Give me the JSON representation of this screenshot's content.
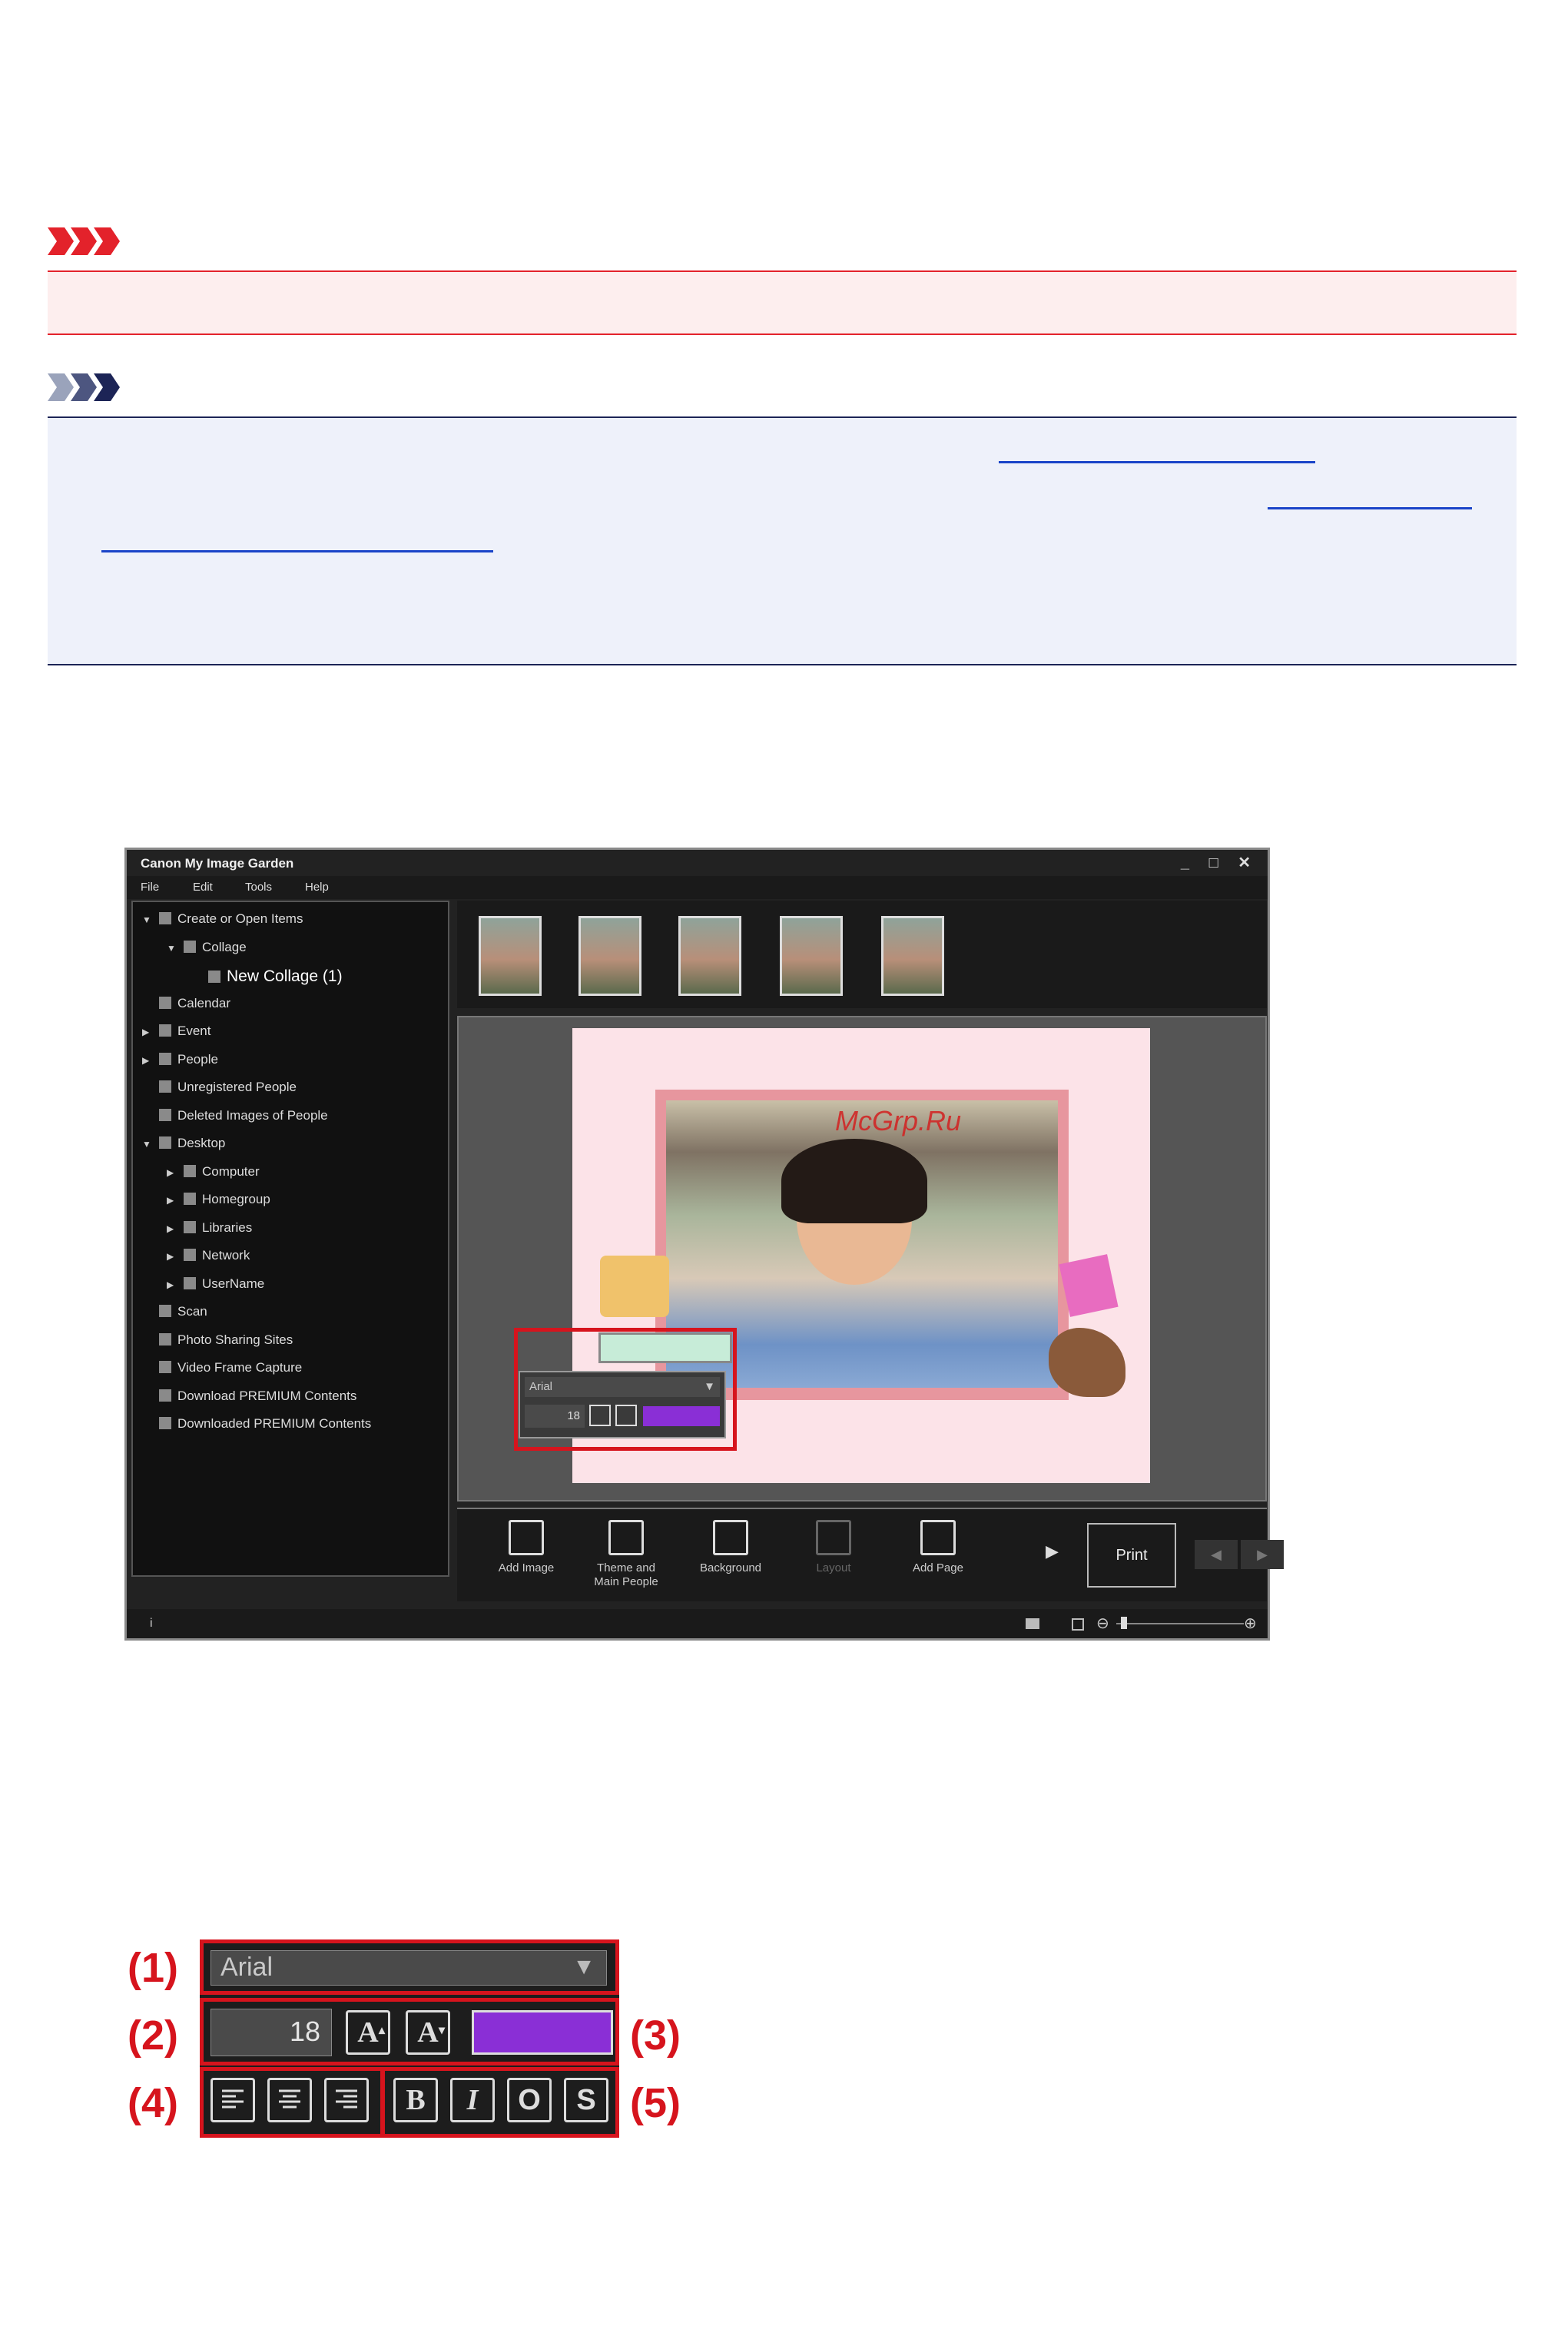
{
  "app": {
    "title": "Canon My Image Garden",
    "window_controls": "_ □ ✕",
    "menu": [
      "File",
      "Edit",
      "Tools",
      "Help"
    ],
    "tree": [
      {
        "label": "Create or Open Items",
        "level": 0,
        "arrow": "▼"
      },
      {
        "label": "Collage",
        "level": 1,
        "arrow": "▼"
      },
      {
        "label": "New Collage (1)",
        "level": 2,
        "arrow": ""
      },
      {
        "label": "Calendar",
        "level": 0,
        "arrow": ""
      },
      {
        "label": "Event",
        "level": 0,
        "arrow": "▶"
      },
      {
        "label": "People",
        "level": 0,
        "arrow": "▶"
      },
      {
        "label": "Unregistered People",
        "level": 0,
        "arrow": ""
      },
      {
        "label": "Deleted Images of People",
        "level": 0,
        "arrow": ""
      },
      {
        "label": "Desktop",
        "level": 0,
        "arrow": "▼"
      },
      {
        "label": "Computer",
        "level": 1,
        "arrow": "▶"
      },
      {
        "label": "Homegroup",
        "level": 1,
        "arrow": "▶"
      },
      {
        "label": "Libraries",
        "level": 1,
        "arrow": "▶"
      },
      {
        "label": "Network",
        "level": 1,
        "arrow": "▶"
      },
      {
        "label": "UserName",
        "level": 1,
        "arrow": "▶"
      },
      {
        "label": "Scan",
        "level": 0,
        "arrow": ""
      },
      {
        "label": "Photo Sharing Sites",
        "level": 0,
        "arrow": ""
      },
      {
        "label": "Video Frame Capture",
        "level": 0,
        "arrow": ""
      },
      {
        "label": "Download PREMIUM Contents",
        "level": 0,
        "arrow": ""
      },
      {
        "label": "Downloaded PREMIUM Contents",
        "level": 0,
        "arrow": ""
      }
    ],
    "watermark": "McGrp.Ru",
    "mini_panel": {
      "font": "Arial",
      "size": "18"
    },
    "toolbar": {
      "buttons": [
        {
          "label": "Add Image",
          "disabled": false
        },
        {
          "label": "Theme and Main People",
          "disabled": false
        },
        {
          "label": "Background",
          "disabled": false
        },
        {
          "label": "Layout",
          "disabled": true
        },
        {
          "label": "Add Page",
          "disabled": false
        }
      ],
      "more_arrow": "▶",
      "print": "Print",
      "nav": [
        "◀",
        "▶"
      ]
    },
    "status": {
      "info": "i",
      "zoom_out": "⊖",
      "zoom_in": "⊕"
    }
  },
  "text_panel": {
    "font": "Arial",
    "dropdown_arrow": "▼",
    "size": "18",
    "increase_glyph": "A",
    "decrease_glyph": "A",
    "color": "#8a2fd6",
    "align": [
      "left",
      "center",
      "right"
    ],
    "styles": [
      "B",
      "I",
      "O",
      "S"
    ],
    "labels": [
      "(1)",
      "(2)",
      "(3)",
      "(4)",
      "(5)"
    ]
  },
  "colors": {
    "important": "#e3222b",
    "note": "#1c2456",
    "callout_red": "#d6141d"
  }
}
